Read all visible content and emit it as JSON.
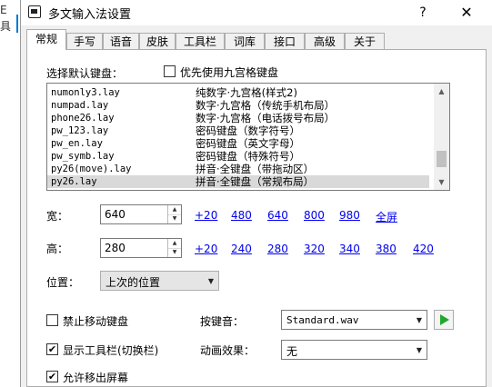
{
  "background_window": {
    "chars": [
      "E",
      "具"
    ]
  },
  "titlebar": {
    "title": "多文输入法设置",
    "help": "?",
    "close": "✕"
  },
  "tabs": [
    {
      "label": "常规",
      "active": true
    },
    {
      "label": "手写"
    },
    {
      "label": "语音"
    },
    {
      "label": "皮肤"
    },
    {
      "label": "工具栏"
    },
    {
      "label": "词库"
    },
    {
      "label": "接口"
    },
    {
      "label": "高级"
    },
    {
      "label": "关于"
    }
  ],
  "keyboard": {
    "label": "选择默认键盘：",
    "prefer_nine_grid": {
      "label": "优先使用九宫格键盘",
      "checked": false
    },
    "list": [
      {
        "file": "numonly3.lay",
        "desc": "纯数字·九宫格(样式2)"
      },
      {
        "file": "numpad.lay",
        "desc": "数字·九宫格（传统手机布局）"
      },
      {
        "file": "phone26.lay",
        "desc": "数字·九宫格（电话拨号布局）"
      },
      {
        "file": "pw_123.lay",
        "desc": "密码键盘（数字符号）"
      },
      {
        "file": "pw_en.lay",
        "desc": "密码键盘（英文字母）"
      },
      {
        "file": "pw_symb.lay",
        "desc": "密码键盘（特殊符号）"
      },
      {
        "file": "py26(move).lay",
        "desc": "拼音·全键盘（带拖动区）"
      },
      {
        "file": "py26.lay",
        "desc": "拼音·全键盘（常规布局）",
        "selected": true
      }
    ],
    "scroll_up": "▲",
    "scroll_down": "▼"
  },
  "width": {
    "label": "宽：",
    "value": "640",
    "presets": [
      "+20",
      "480",
      "640",
      "800",
      "980",
      "全屏"
    ]
  },
  "height": {
    "label": "高：",
    "value": "280",
    "presets": [
      "+20",
      "240",
      "280",
      "320",
      "340",
      "380",
      "420"
    ]
  },
  "spin_up": "▲",
  "spin_down": "▼",
  "position": {
    "label": "位置：",
    "value": "上次的位置"
  },
  "options": {
    "no_move": {
      "label": "禁止移动键盘",
      "checked": false
    },
    "show_toolbar": {
      "label": "显示工具栏(切换栏)",
      "checked": true
    },
    "allow_offscreen": {
      "label": "允许移出屏幕",
      "checked": true
    },
    "check_mark": "✔"
  },
  "key_sound": {
    "label": "按键音：",
    "value": "Standard.wav"
  },
  "animation": {
    "label": "动画效果：",
    "value": "无"
  },
  "dropdown_glyph": "▼",
  "colors": {
    "play_green": "#22a82c",
    "link": "#0000ee",
    "selection": "#d9d9d9"
  }
}
